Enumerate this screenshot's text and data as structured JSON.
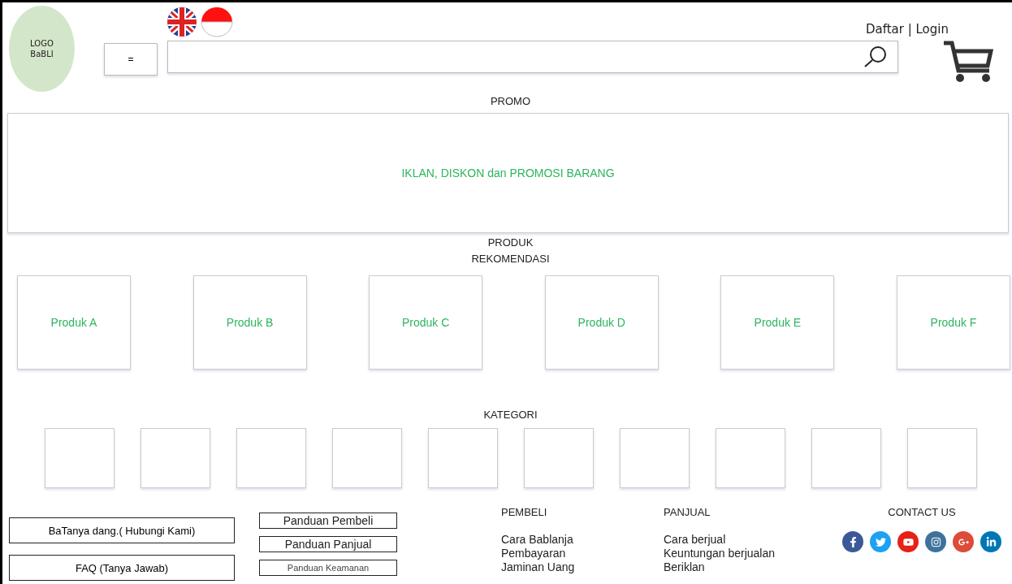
{
  "header": {
    "logo": [
      "LOGO",
      "BaBLI"
    ],
    "menu_button": "=",
    "auth": "Daftar | Login"
  },
  "promo": {
    "title": "PROMO",
    "banner": "IKLAN, DISKON dan PROMOSI BARANG"
  },
  "recommended": {
    "title": [
      "PRODUK",
      "REKOMENDASI"
    ],
    "products": [
      "Produk A",
      "Produk B",
      "Produk C",
      "Produk D",
      "Produk E",
      "Produk F"
    ]
  },
  "categories": {
    "title": "KATEGORI"
  },
  "footer": {
    "help_buttons": [
      "BaTanya dang.( Hubungi Kami)",
      "FAQ (Tanya Jawab)"
    ],
    "guide_buttons": [
      {
        "label": "Panduan Pembeli",
        "kind": "normal"
      },
      {
        "label": "Panduan Panjual",
        "kind": "normal"
      },
      {
        "label": "Panduan Keamanan",
        "kind": "small"
      }
    ],
    "columns": [
      {
        "title": "PEMBELI",
        "links": [
          "Cara Bablanja",
          "Pembayaran",
          "Jaminan Uang"
        ]
      },
      {
        "title": "PANJUAL",
        "links": [
          "Cara berjual",
          "Keuntungan berjualan",
          "Beriklan"
        ]
      }
    ],
    "contact": {
      "title": "CONTACT US",
      "socials": [
        {
          "kind": "facebook",
          "color": "#3b5998"
        },
        {
          "kind": "twitter",
          "color": "#1da1f2"
        },
        {
          "kind": "youtube",
          "color": "#e62117"
        },
        {
          "kind": "instagram",
          "color": "#3f729b"
        },
        {
          "kind": "googleplus",
          "color": "#dd4b39"
        },
        {
          "kind": "linkedin",
          "color": "#0077b5"
        }
      ]
    }
  }
}
